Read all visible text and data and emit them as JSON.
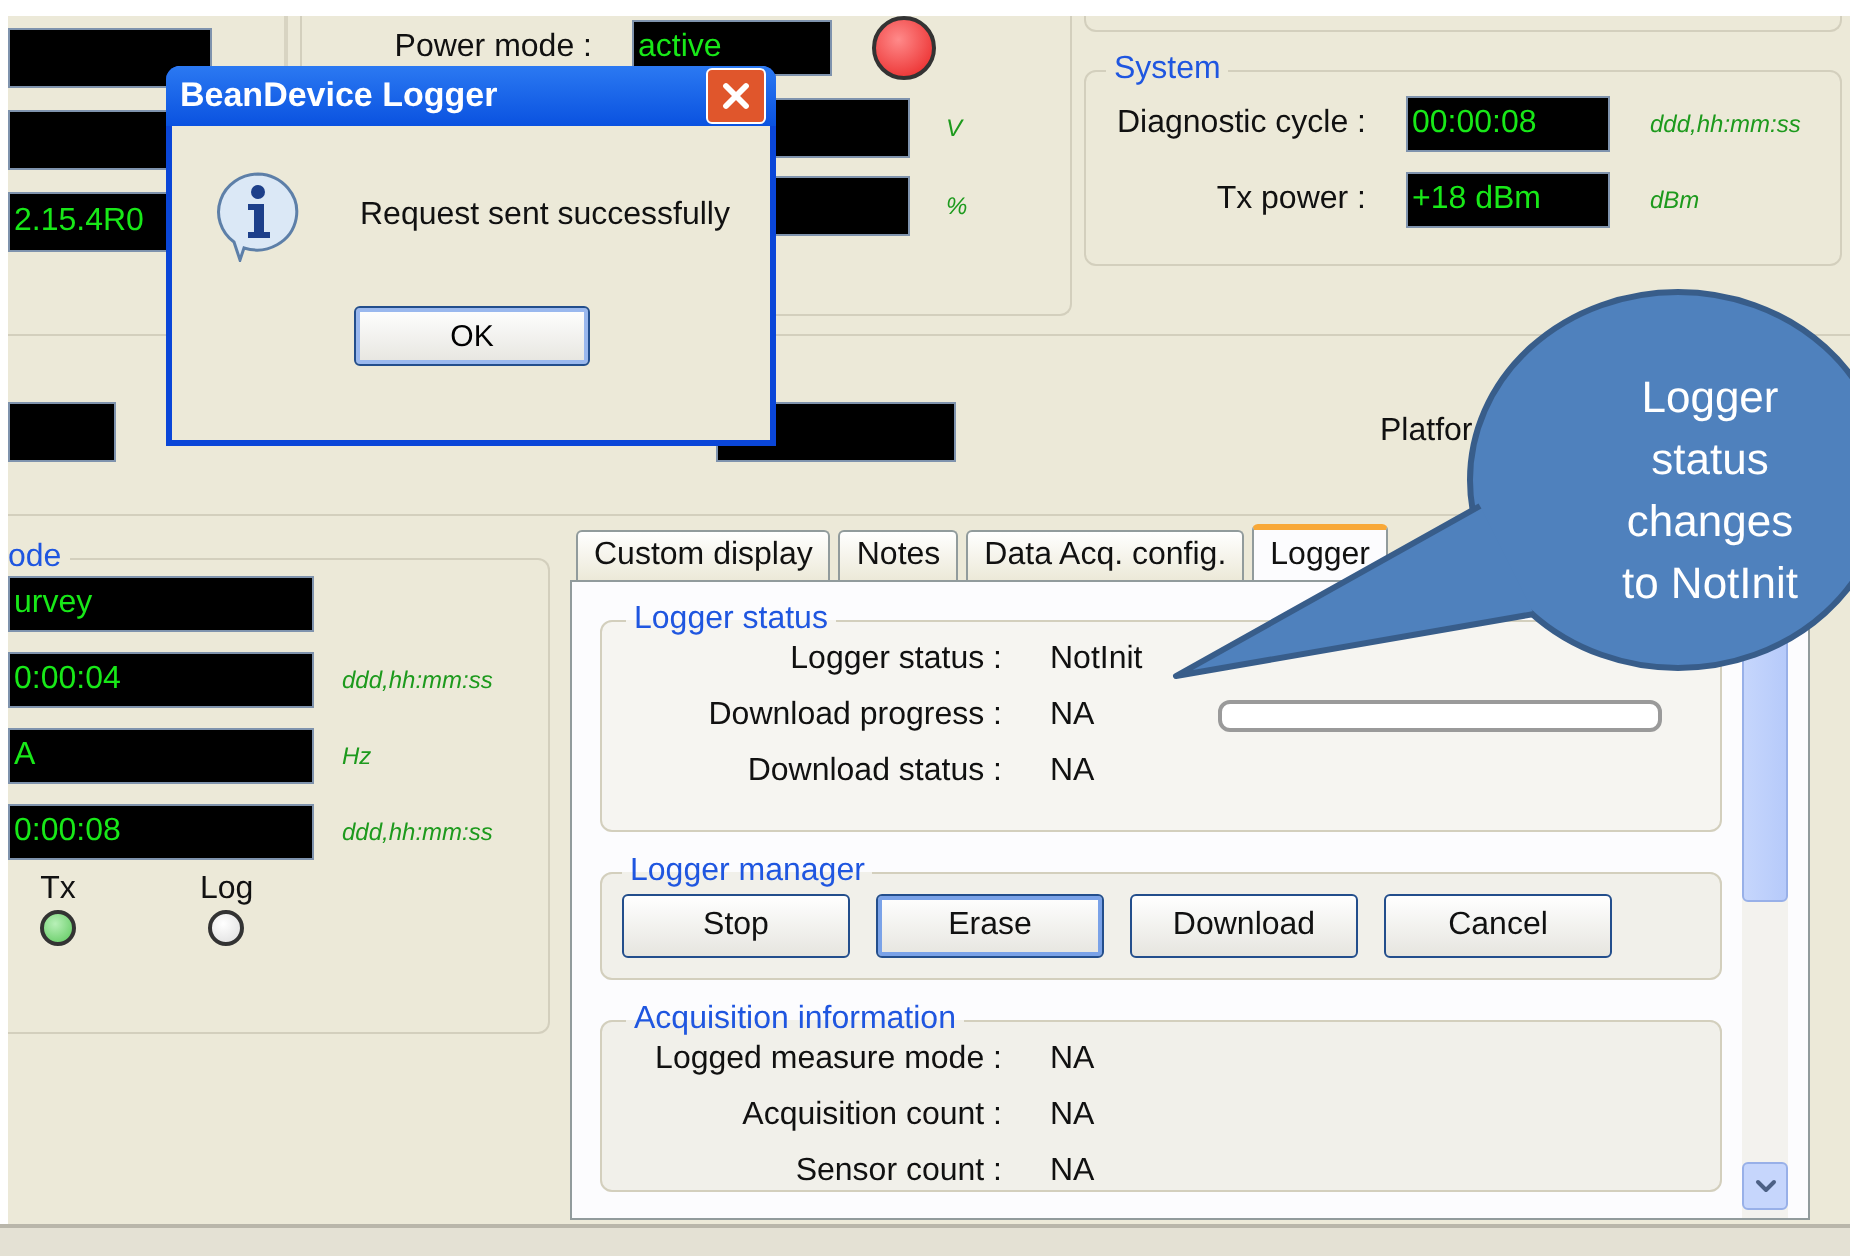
{
  "top_left_panel": {
    "fields": [
      {
        "kind": "blank"
      },
      {
        "kind": "blank"
      },
      {
        "kind": "text",
        "value": "2.15.4R0"
      }
    ]
  },
  "power_panel": {
    "label": "Power mode :",
    "value": "active",
    "led_on": true,
    "units": [
      "V",
      "%"
    ]
  },
  "system": {
    "title": "System",
    "rows": [
      {
        "label": "Diagnostic cycle :",
        "value": "00:00:08",
        "unit": "ddd,hh:mm:ss"
      },
      {
        "label": "Tx power :",
        "value": "+18 dBm",
        "unit": "dBm"
      }
    ]
  },
  "platform_label": "Platfor",
  "mode_panel": {
    "title": "ode",
    "rows": [
      {
        "value": "urvey"
      },
      {
        "value": "0:00:04",
        "unit": "ddd,hh:mm:ss"
      },
      {
        "value": "A",
        "unit": "Hz"
      },
      {
        "value": "0:00:08",
        "unit": "ddd,hh:mm:ss"
      }
    ],
    "leds": [
      {
        "label": "Tx",
        "on": true
      },
      {
        "label": "Log",
        "on": false
      }
    ]
  },
  "tabs": [
    {
      "label": "Custom display",
      "selected": false
    },
    {
      "label": "Notes",
      "selected": false
    },
    {
      "label": "Data Acq. config.",
      "selected": false
    },
    {
      "label": "Logger",
      "selected": true
    }
  ],
  "logger_status": {
    "title": "Logger status",
    "rows": [
      {
        "kind": "text",
        "label": "Logger status :",
        "value": "NotInit"
      },
      {
        "kind": "progress",
        "label": "Download progress :",
        "value": "NA",
        "level": 0
      },
      {
        "kind": "text",
        "label": "Download status :",
        "value": "NA"
      }
    ]
  },
  "logger_manager": {
    "title": "Logger manager",
    "buttons": [
      {
        "label": "Stop",
        "focused": false
      },
      {
        "label": "Erase",
        "focused": true
      },
      {
        "label": "Download",
        "focused": false
      },
      {
        "label": "Cancel",
        "focused": false
      }
    ]
  },
  "acquisition": {
    "title": "Acquisition information",
    "rows": [
      {
        "label": "Logged measure mode :",
        "value": "NA"
      },
      {
        "label": "Acquisition count :",
        "value": "NA"
      },
      {
        "label": "Sensor count :",
        "value": "NA"
      }
    ]
  },
  "dialog": {
    "title": "BeanDevice Logger",
    "message": "Request sent successfully",
    "button": "OK"
  },
  "callout": {
    "text": "Logger status changes to NotInit"
  }
}
